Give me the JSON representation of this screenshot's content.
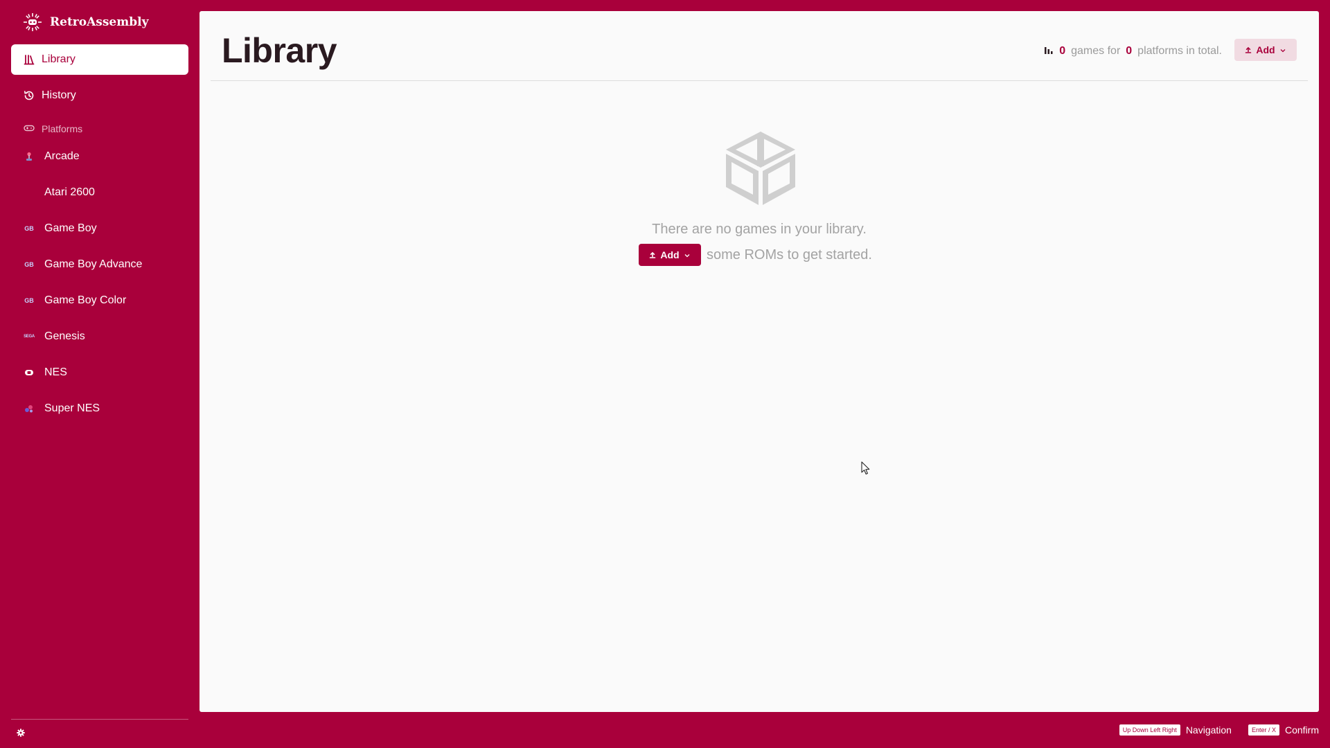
{
  "app": {
    "name": "RetroAssembly"
  },
  "nav": {
    "library": "Library",
    "history": "History",
    "platforms_label": "Platforms"
  },
  "platforms": [
    {
      "label": "Arcade",
      "icon": "arcade-joystick-icon"
    },
    {
      "label": "Atari 2600",
      "icon": ""
    },
    {
      "label": "Game Boy",
      "icon": "gb-icon",
      "badge": "GB"
    },
    {
      "label": "Game Boy Advance",
      "icon": "gba-icon",
      "badge": "GB"
    },
    {
      "label": "Game Boy Color",
      "icon": "gbc-icon",
      "badge": "GB"
    },
    {
      "label": "Genesis",
      "icon": "genesis-icon",
      "badge": "SEGA"
    },
    {
      "label": "NES",
      "icon": "nes-icon"
    },
    {
      "label": "Super NES",
      "icon": "snes-icon"
    }
  ],
  "main": {
    "title": "Library",
    "stats": {
      "games_count": "0",
      "games_text": "games for",
      "platforms_count": "0",
      "platforms_text": "platforms in total."
    },
    "add_label": "Add",
    "empty": {
      "line1": "There are no games in your library.",
      "add_label": "Add",
      "line2": "some ROMs to get started."
    }
  },
  "hints": {
    "nav_keys": "Up Down Left Right",
    "nav_label": "Navigation",
    "confirm_keys": "Enter / X",
    "confirm_label": "Confirm"
  },
  "colors": {
    "brand": "#a9003b",
    "panel": "#fafafa",
    "muted_text": "#a3a3a3"
  }
}
